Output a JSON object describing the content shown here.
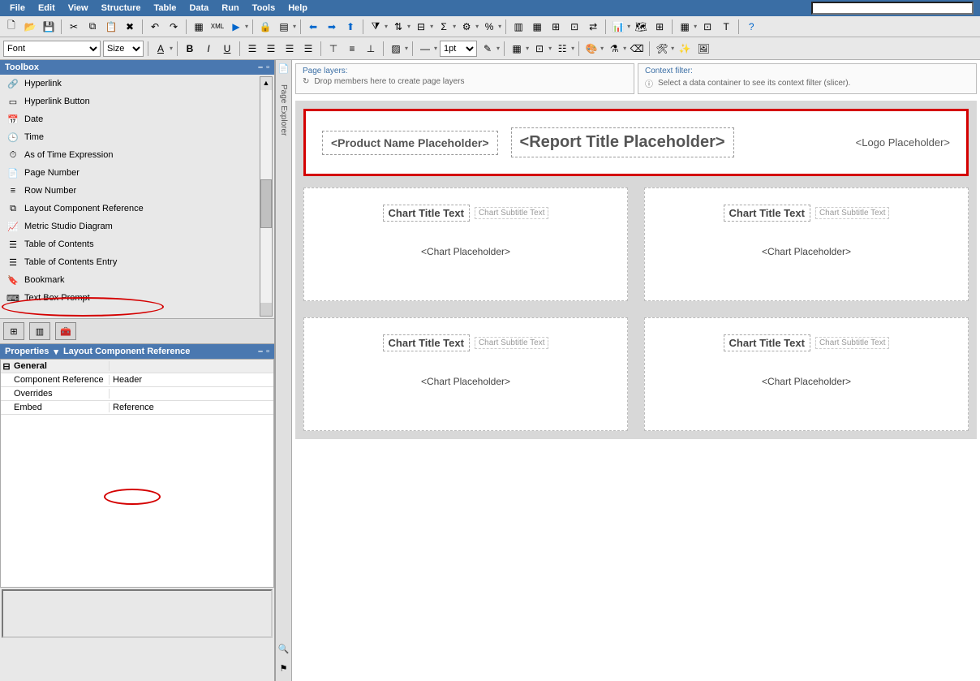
{
  "menu": {
    "items": [
      "File",
      "Edit",
      "View",
      "Structure",
      "Table",
      "Data",
      "Run",
      "Tools",
      "Help"
    ]
  },
  "format": {
    "font_ph": "Font",
    "size_ph": "Size",
    "linewidth": "1pt"
  },
  "toolbox": {
    "title": "Toolbox",
    "items": [
      {
        "icon": "🔗",
        "label": "Hyperlink"
      },
      {
        "icon": "▭",
        "label": "Hyperlink Button"
      },
      {
        "icon": "📅",
        "label": "Date"
      },
      {
        "icon": "🕒",
        "label": "Time"
      },
      {
        "icon": "⏱",
        "label": "As of Time Expression"
      },
      {
        "icon": "📄",
        "label": "Page Number"
      },
      {
        "icon": "≡",
        "label": "Row Number"
      },
      {
        "icon": "⧉",
        "label": "Layout Component Reference"
      },
      {
        "icon": "📈",
        "label": "Metric Studio Diagram"
      },
      {
        "icon": "☰",
        "label": "Table of Contents"
      },
      {
        "icon": "☰",
        "label": "Table of Contents Entry"
      },
      {
        "icon": "🔖",
        "label": "Bookmark"
      },
      {
        "icon": "⌨",
        "label": "Text Box Prompt"
      }
    ]
  },
  "properties": {
    "title": "Properties",
    "subtitle": "Layout Component Reference",
    "group": "General",
    "rows": [
      {
        "key": "Component Reference",
        "val": "Header"
      },
      {
        "key": "Overrides",
        "val": ""
      },
      {
        "key": "Embed",
        "val": "Reference"
      }
    ]
  },
  "canvas": {
    "pagelayers": {
      "title": "Page layers:",
      "hint": "Drop members here to create page layers"
    },
    "contextfilter": {
      "title": "Context filter:",
      "hint": "Select a data container to see its context filter (slicer)."
    },
    "explorer_label": "Page Explorer",
    "header": {
      "product": "<Product Name Placeholder>",
      "title": "<Report Title Placeholder>",
      "logo": "<Logo Placeholder>"
    },
    "chart": {
      "title": "Chart Title Text",
      "subtitle": "Chart Subtitle Text",
      "placeholder": "<Chart Placeholder>"
    }
  }
}
